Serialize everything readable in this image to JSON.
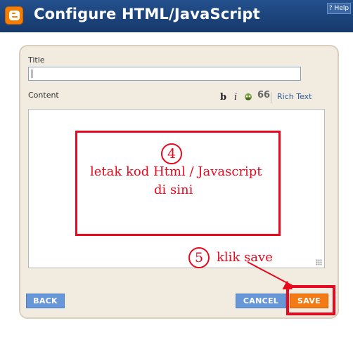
{
  "header": {
    "title": "Configure HTML/JavaScript",
    "help_label": "? Help",
    "logo": "blogger-logo-icon"
  },
  "form": {
    "title_label": "Title",
    "title_value": "",
    "content_label": "Content",
    "content_value": ""
  },
  "toolbar": {
    "bold_label": "b",
    "italic_label": "i",
    "image_icon": "image-icon",
    "quote_label": "66",
    "rich_text_label": "Rich Text"
  },
  "annotations": {
    "step4_number": "4",
    "step4_line1": "letak kod Html / Javascript",
    "step4_line2": "di sini",
    "step5_number": "5",
    "step5_text": "klik save"
  },
  "buttons": {
    "back_label": "BACK",
    "cancel_label": "CANCEL",
    "save_label": "SAVE"
  },
  "colors": {
    "header_bg": "#1c4478",
    "panel_bg": "#f2ece0",
    "button_blue": "#6897d8",
    "button_orange": "#f27b16",
    "annotation_red": "#e8091e"
  }
}
